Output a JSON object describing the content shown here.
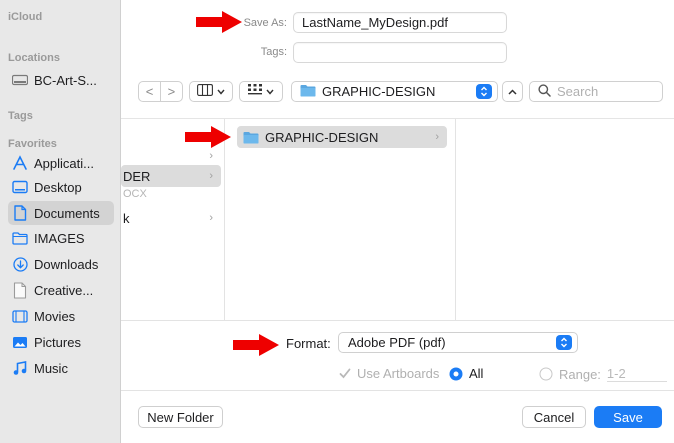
{
  "sidebar": {
    "sections": {
      "icloud": "iCloud",
      "locations": "Locations",
      "tags": "Tags",
      "favorites": "Favorites"
    },
    "locations": [
      {
        "label": "BC-Art-S...",
        "icon": "drive-icon"
      }
    ],
    "favorites": [
      {
        "label": "Applicati...",
        "icon": "applications-icon",
        "selected": false
      },
      {
        "label": "Desktop",
        "icon": "desktop-icon",
        "selected": false
      },
      {
        "label": "Documents",
        "icon": "documents-icon",
        "selected": true
      },
      {
        "label": "IMAGES",
        "icon": "folder-icon",
        "selected": false
      },
      {
        "label": "Downloads",
        "icon": "downloads-icon",
        "selected": false
      },
      {
        "label": "Creative...",
        "icon": "document-icon",
        "selected": false
      },
      {
        "label": "Movies",
        "icon": "movies-icon",
        "selected": false
      },
      {
        "label": "Pictures",
        "icon": "pictures-icon",
        "selected": false
      },
      {
        "label": "Music",
        "icon": "music-icon",
        "selected": false
      }
    ]
  },
  "header": {
    "save_as_label": "Save As:",
    "save_as_value": "LastName_MyDesign.pdf",
    "tags_label": "Tags:",
    "tags_value": ""
  },
  "toolbar": {
    "back": "<",
    "forward": ">",
    "location": "GRAPHIC-DESIGN",
    "search_placeholder": "Search"
  },
  "browser": {
    "column1": [
      {
        "label": "",
        "chevron": true,
        "selected": false,
        "dim": false
      },
      {
        "label": "DER",
        "chevron": true,
        "selected": true,
        "dim": false
      },
      {
        "label": "OCX",
        "chevron": false,
        "selected": false,
        "dim": true
      },
      {
        "label": "k",
        "chevron": true,
        "selected": false,
        "dim": false
      }
    ],
    "column2": [
      {
        "label": "GRAPHIC-DESIGN",
        "chevron": true,
        "selected": true
      }
    ]
  },
  "format": {
    "label": "Format:",
    "value": "Adobe PDF (pdf)"
  },
  "options": {
    "use_artboards": "Use Artboards",
    "all": "All",
    "range_label": "Range:",
    "range_value": "1-2"
  },
  "buttons": {
    "new_folder": "New Folder",
    "cancel": "Cancel",
    "save": "Save"
  },
  "colors": {
    "accent": "#1b7cf5",
    "arrow": "#ee0000",
    "folder": "#5aa7e0"
  }
}
